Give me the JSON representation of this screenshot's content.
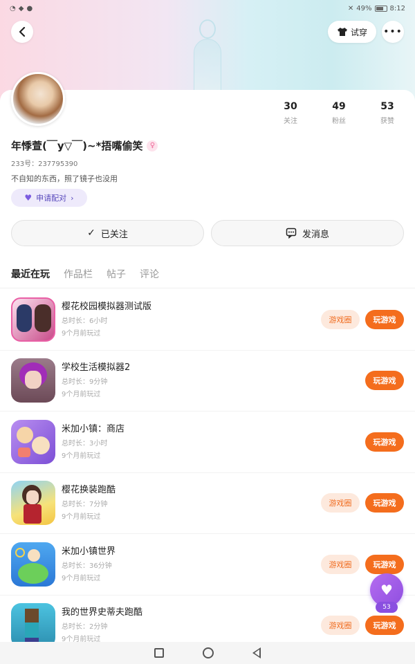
{
  "status_bar": {
    "right_text": "49%",
    "time": "8:12"
  },
  "header": {
    "tryon_label": "试穿",
    "more_label": "•••"
  },
  "profile": {
    "stats": [
      {
        "num": "30",
        "label": "关注"
      },
      {
        "num": "49",
        "label": "粉丝"
      },
      {
        "num": "53",
        "label": "获赞"
      }
    ],
    "nickname": "年悸萱(￣y▽￣)~*捂嘴偷笑",
    "uid": "233号：237795390",
    "bio": "不自知的东西，照了镜子也没用",
    "pair_label": "申请配对",
    "follow_label": "已关注",
    "message_label": "发消息"
  },
  "tabs": [
    "最近在玩",
    "作品栏",
    "帖子",
    "评论"
  ],
  "games": [
    {
      "name": "樱花校园模拟器测试版",
      "duration": "总时长：6小时",
      "last": "9个月前玩过",
      "circle": "游戏圈",
      "play": "玩游戏"
    },
    {
      "name": "学校生活模拟器2",
      "duration": "总时长：9分钟",
      "last": "9个月前玩过",
      "circle": "",
      "play": "玩游戏"
    },
    {
      "name": "米加小镇：商店",
      "duration": "总时长：3小时",
      "last": "9个月前玩过",
      "circle": "",
      "play": "玩游戏"
    },
    {
      "name": "樱花换装跑酷",
      "duration": "总时长：7分钟",
      "last": "9个月前玩过",
      "circle": "游戏圈",
      "play": "玩游戏"
    },
    {
      "name": "米加小镇世界",
      "duration": "总时长：36分钟",
      "last": "9个月前玩过",
      "circle": "游戏圈",
      "play": "玩游戏"
    },
    {
      "name": "我的世界史蒂夫跑酷",
      "duration": "总时长：2分钟",
      "last": "9个月前玩过",
      "circle": "游戏圈",
      "play": "玩游戏"
    }
  ],
  "fab": {
    "count": "53"
  },
  "colors": {
    "accent": "#f46d1d",
    "accent_light": "#fde9dd",
    "purple": "#8f4fe0"
  }
}
